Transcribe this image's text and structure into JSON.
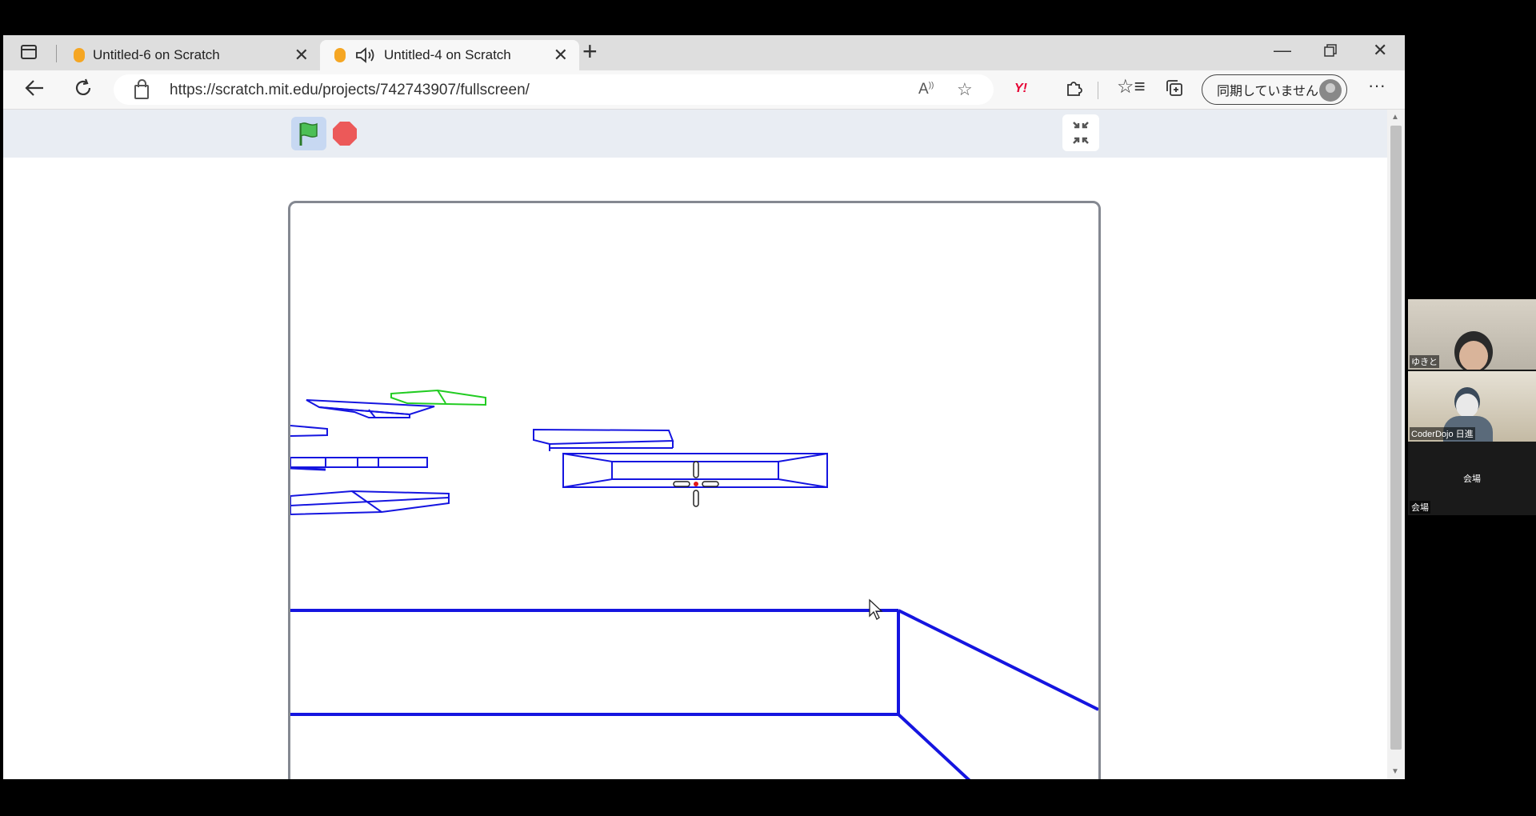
{
  "browser": {
    "tabs": [
      {
        "title": "Untitled-6 on Scratch",
        "active": false
      },
      {
        "title": "Untitled-4 on Scratch",
        "active": true
      }
    ],
    "url": "https://scratch.mit.edu/projects/742743907/fullscreen/",
    "profile_label": "同期していません",
    "icons": [
      "tab-actions-icon",
      "back-icon",
      "refresh-icon",
      "lock-icon",
      "read-aloud-icon",
      "favorite-icon",
      "yahoo-icon",
      "extensions-icon",
      "favorites-icon",
      "collections-icon",
      "more-icon"
    ],
    "colors": {
      "tabstrip": "#dedede",
      "toolbar": "#f7f7f7"
    }
  },
  "scratch": {
    "controls": [
      "green-flag",
      "stop"
    ],
    "stage_lines_color": "#1515e0",
    "highlight_color": "#22cc22"
  },
  "video_call": {
    "participants": [
      {
        "name": "ゆきと"
      },
      {
        "name": "CoderDojo 日進"
      },
      {
        "name": "会場",
        "center_label": "会場"
      }
    ]
  }
}
